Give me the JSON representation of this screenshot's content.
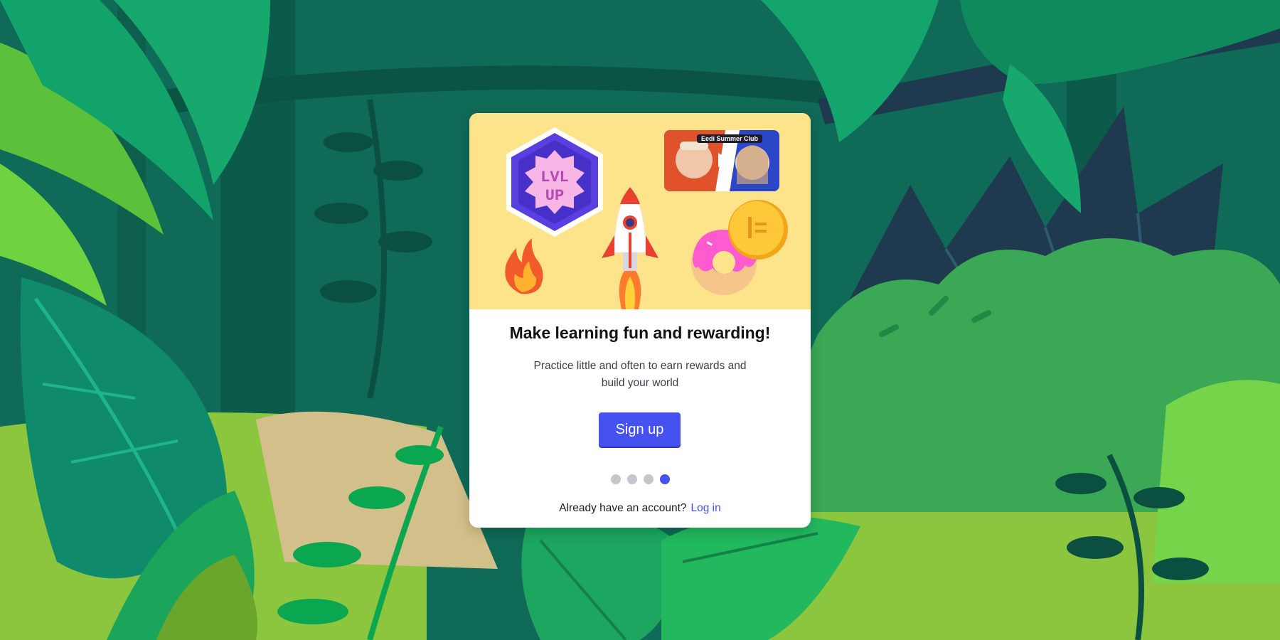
{
  "card": {
    "title": "Make learning fun and rewarding!",
    "subtitle": "Practice little and often to earn rewards and build your world",
    "signup_label": "Sign up",
    "login_prompt": "Already have an account?",
    "login_label": "Log in",
    "carousel": {
      "total": 4,
      "active_index": 3
    }
  },
  "hero": {
    "badge_text_line1": "LVL",
    "badge_text_line2": "UP",
    "video_title": "Eedi Summer Club",
    "icons": [
      "lvl-up-badge-icon",
      "fire-icon",
      "rocket-icon",
      "video-thumbnail",
      "donut-icon",
      "coin-icon"
    ]
  },
  "colors": {
    "accent": "#4552f0",
    "hero_bg": "#fde38a",
    "dot_inactive": "#c6c6cc"
  }
}
